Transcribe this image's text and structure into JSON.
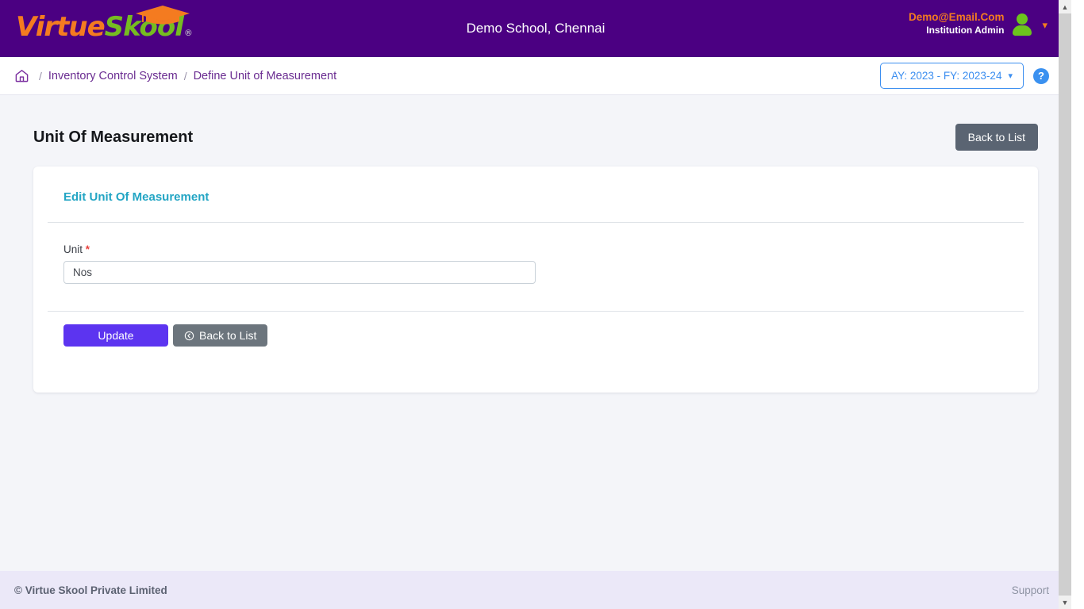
{
  "topbar": {
    "logo": {
      "part1": "Virtue",
      "part2": "Skool",
      "registered": "®",
      "icon": "graduation-cap-icon"
    },
    "school_title": "Demo School, Chennai",
    "user": {
      "email": "Demo@Email.Com",
      "role": "Institution Admin",
      "avatar_icon": "user-avatar-icon",
      "caret_icon": "chevron-down-icon"
    },
    "colors": {
      "background": "#4b0082",
      "email": "#f47b20",
      "avatar": "#6cc51d"
    }
  },
  "breadcrumb": {
    "home_icon": "home-icon",
    "separator": "/",
    "items": [
      {
        "label": "Inventory Control System",
        "current": false
      },
      {
        "label": "Define Unit of Measurement",
        "current": true
      }
    ],
    "academic_year": {
      "label": "AY: 2023 - FY: 2023-24",
      "caret": "⌄"
    },
    "help": {
      "label": "?",
      "icon": "help-circle-icon"
    },
    "colors": {
      "link": "#6a2c91",
      "ay_border": "#3b8ef0",
      "help_bg": "#3b91f0"
    }
  },
  "page": {
    "title": "Unit Of Measurement",
    "back_to_list_top": "Back to List"
  },
  "form": {
    "panel_title": "Edit Unit Of Measurement",
    "field": {
      "label": "Unit",
      "required_marker": "*",
      "value": "Nos",
      "placeholder": "Unit"
    },
    "buttons": {
      "update": "Update",
      "back_to_list": "Back to List",
      "back_icon": "circle-arrow-left-icon"
    },
    "colors": {
      "panel_title": "#23a5c4",
      "update_bg": "#5c34f0",
      "back_bg": "#6c757d"
    }
  },
  "footer": {
    "copyright": "© Virtue Skool Private Limited",
    "support": "Support"
  },
  "scrollbar": {
    "up_arrow": "▲",
    "down_arrow": "▼"
  }
}
